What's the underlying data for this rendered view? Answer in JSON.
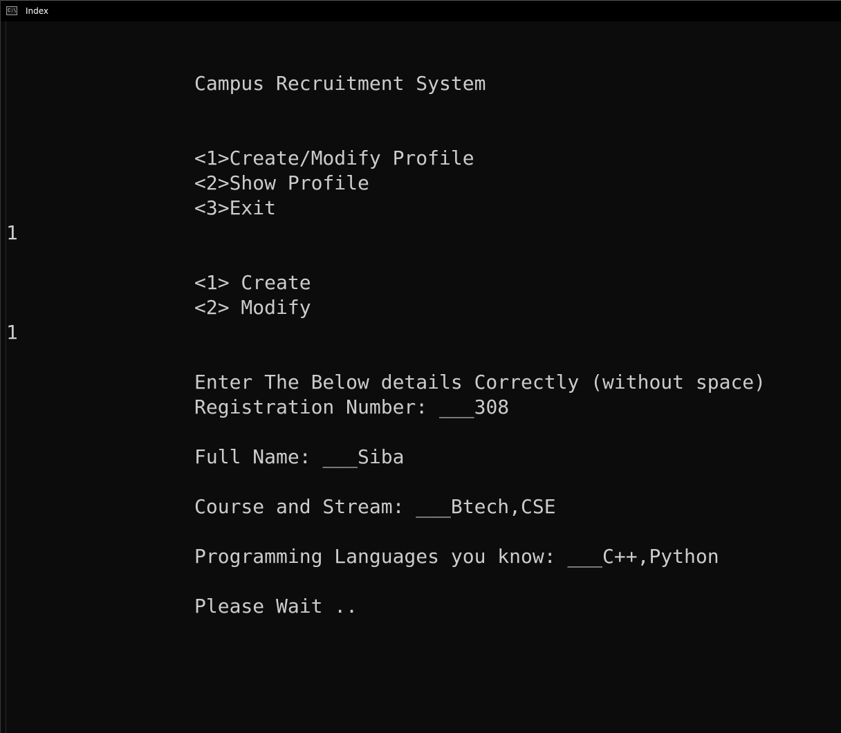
{
  "window": {
    "title": "Index",
    "icon": "console-icon"
  },
  "console": {
    "header": "Campus Recruitment System",
    "main_menu": [
      "<1>Create/Modify Profile",
      "<2>Show Profile",
      "<3>Exit"
    ],
    "input_1": "1",
    "sub_menu": [
      "<1> Create",
      "<2> Modify"
    ],
    "input_2": "1",
    "instruction": "Enter The Below details Correctly (without space)",
    "fields": [
      {
        "label": "Registration Number: ",
        "value": "___308"
      },
      {
        "label": "Full Name: ",
        "value": "___Siba"
      },
      {
        "label": "Course and Stream: ",
        "value": "___Btech,CSE"
      },
      {
        "label": "Programming Languages you know: ",
        "value": "___C++,Python"
      }
    ],
    "status": "Please Wait .."
  },
  "colors": {
    "background": "#0c0c0c",
    "text": "#cccccc",
    "titlebar": "#000000"
  }
}
